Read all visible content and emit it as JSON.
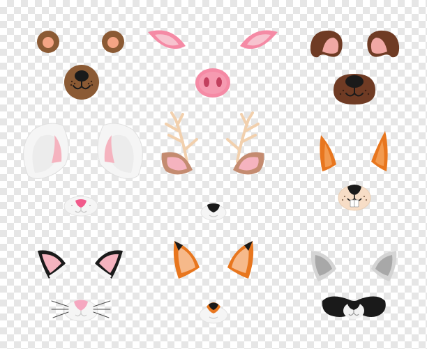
{
  "scene": {
    "background": "transparency-checkerboard",
    "masks": [
      {
        "animal": "bear",
        "ears": "round-ears",
        "face": "snout-with-nose-and-mouth"
      },
      {
        "animal": "pig",
        "ears": "pointed-pink-ears",
        "face": "pig-snout"
      },
      {
        "animal": "dog",
        "ears": "floppy-brown-ears",
        "face": "dog-nose"
      },
      {
        "animal": "rabbit",
        "ears": "long-white-ears",
        "face": "rabbit-nose"
      },
      {
        "animal": "deer",
        "ears": "antlers-and-ears",
        "face": "deer-nose"
      },
      {
        "animal": "squirrel",
        "ears": "orange-pointed-ears",
        "face": "squirrel-nose-and-teeth"
      },
      {
        "animal": "cat",
        "ears": "black-pink-ears",
        "face": "cat-nose-with-whiskers"
      },
      {
        "animal": "fox",
        "ears": "orange-fox-ears",
        "face": "fox-nose"
      },
      {
        "animal": "raccoon",
        "ears": "grey-ears",
        "face": "raccoon-mask"
      }
    ],
    "colors": {
      "bear_brown": "#8b5a34",
      "bear_inner": "#f4a484",
      "pig_pink": "#f58aa5",
      "pig_inner": "#f7c3cf",
      "dog_brown": "#6f3b24",
      "dog_inner": "#f0a8a4",
      "white_fur": "#f5f5f5",
      "grey_fur": "#cfcfcf",
      "inner_pink": "#f5b3bf",
      "antler": "#f2d0ad",
      "deer_ear": "#c48b70",
      "orange": "#e8761e",
      "black": "#1a1a1a"
    }
  }
}
